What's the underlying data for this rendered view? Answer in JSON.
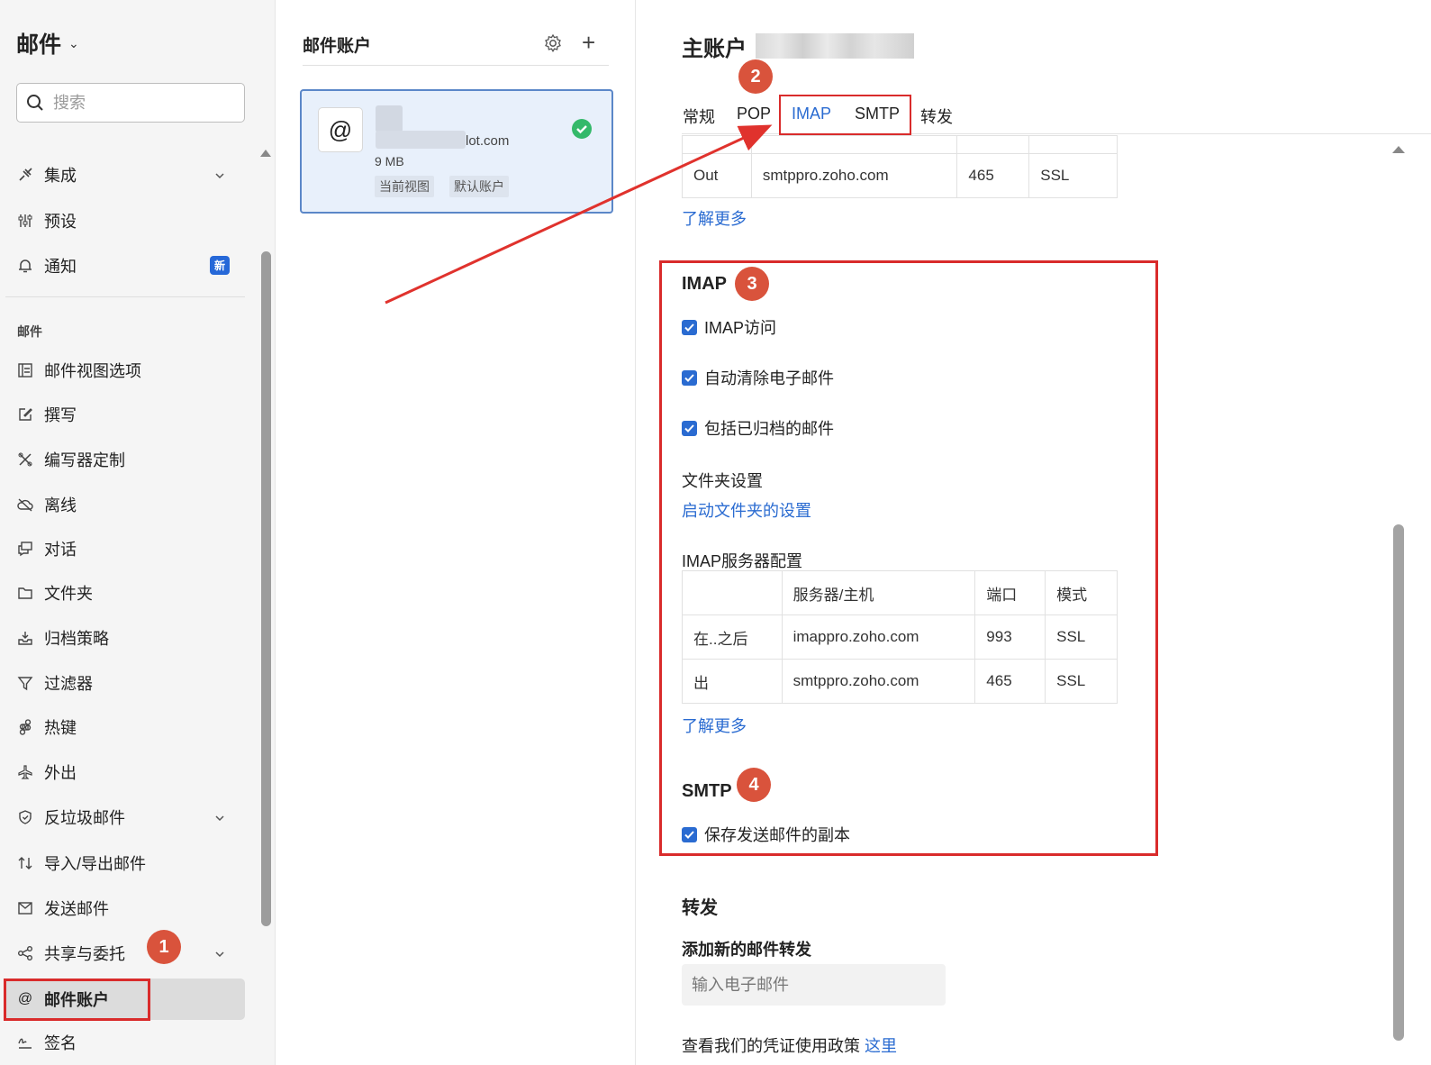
{
  "sidebar": {
    "title": "邮件",
    "search_placeholder": "搜索",
    "section_mail": "邮件",
    "items": [
      {
        "label": "集成",
        "icon": "plug-icon"
      },
      {
        "label": "预设",
        "icon": "sliders-icon"
      },
      {
        "label": "通知",
        "icon": "bell-icon",
        "badge": "新"
      },
      {
        "label": "邮件视图选项",
        "icon": "layout-icon"
      },
      {
        "label": "撰写",
        "icon": "compose-icon"
      },
      {
        "label": "编写器定制",
        "icon": "tools-icon"
      },
      {
        "label": "离线",
        "icon": "cloud-off-icon"
      },
      {
        "label": "对话",
        "icon": "chat-icon"
      },
      {
        "label": "文件夹",
        "icon": "folder-icon"
      },
      {
        "label": "归档策略",
        "icon": "archive-icon"
      },
      {
        "label": "过滤器",
        "icon": "filter-icon"
      },
      {
        "label": "热键",
        "icon": "command-icon"
      },
      {
        "label": "外出",
        "icon": "plane-icon"
      },
      {
        "label": "反垃圾邮件",
        "icon": "shield-icon"
      },
      {
        "label": "导入/导出邮件",
        "icon": "import-export-icon"
      },
      {
        "label": "发送邮件",
        "icon": "send-mail-icon"
      },
      {
        "label": "共享与委托",
        "icon": "share-icon"
      },
      {
        "label": "邮件账户",
        "icon": "at-icon"
      },
      {
        "label": "签名",
        "icon": "signature-icon"
      }
    ]
  },
  "accounts": {
    "header": "邮件账户",
    "card": {
      "domain": "lot.com",
      "size": "9 MB",
      "tags": [
        "当前视图",
        "默认账户"
      ]
    }
  },
  "content": {
    "title": "主账户",
    "tabs": [
      "常规",
      "POP",
      "IMAP",
      "SMTP",
      "转发"
    ],
    "top_table": {
      "rows": [
        [
          "Out",
          "smtppro.zoho.com",
          "465",
          "SSL"
        ]
      ]
    },
    "learn_more": "了解更多",
    "imap": {
      "heading": "IMAP",
      "checkboxes": [
        "IMAP访问",
        "自动清除电子邮件",
        "包括已归档的邮件"
      ],
      "folder_settings_label": "文件夹设置",
      "folder_settings_link": "启动文件夹的设置",
      "server_config_label": "IMAP服务器配置",
      "table": {
        "headers": [
          "",
          "服务器/主机",
          "端口",
          "模式"
        ],
        "rows": [
          [
            "在..之后",
            "imappro.zoho.com",
            "993",
            "SSL"
          ],
          [
            "出",
            "smtppro.zoho.com",
            "465",
            "SSL"
          ]
        ]
      }
    },
    "smtp": {
      "heading": "SMTP",
      "checkbox": "保存发送邮件的副本"
    },
    "forward": {
      "heading": "转发",
      "subheading": "添加新的邮件转发",
      "input_placeholder": "输入电子邮件",
      "policy_text": "查看我们的凭证使用政策",
      "policy_link": "这里"
    }
  },
  "annotations": {
    "markers": [
      "1",
      "2",
      "3",
      "4"
    ],
    "highlight_color": "#d92b2b",
    "marker_color": "#d9533c"
  }
}
